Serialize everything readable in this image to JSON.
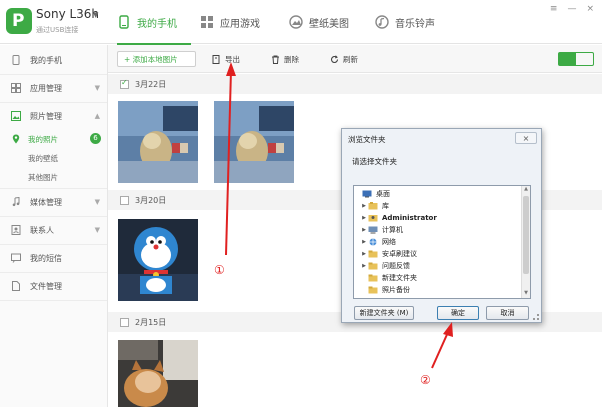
{
  "device": {
    "name": "Sony L36h",
    "subtitle": "通过USB连接",
    "logo_letter": "P"
  },
  "tabs": [
    {
      "label": "我的手机"
    },
    {
      "label": "应用游戏"
    },
    {
      "label": "壁纸美图"
    },
    {
      "label": "音乐铃声"
    }
  ],
  "window_controls": {
    "menu": "≡",
    "minimize": "—",
    "close": "×"
  },
  "sidebar": {
    "my_phone": "我的手机",
    "app_mgmt": "应用管理",
    "photo_mgmt": "照片管理",
    "my_photos": "我的照片",
    "my_photos_count": "6",
    "my_wallpapers": "我的壁纸",
    "other_pictures": "其他图片",
    "media_mgmt": "媒体管理",
    "contacts": "联系人",
    "sms": "我的短信",
    "file_mgmt": "文件管理"
  },
  "toolbar": {
    "add_local": "+ 添加本地图片",
    "export": "导出",
    "delete": "删除",
    "refresh": "刷新"
  },
  "groups": [
    {
      "date": "3月22日",
      "checked": true
    },
    {
      "date": "3月20日",
      "checked": false
    },
    {
      "date": "2月15日",
      "checked": false
    }
  ],
  "dialog": {
    "title": "浏览文件夹",
    "close": "×",
    "prompt": "请选择文件夹",
    "tree": [
      {
        "label": "桌面",
        "bold": false
      },
      {
        "label": "库",
        "bold": false
      },
      {
        "label": "Administrator",
        "bold": true
      },
      {
        "label": "计算机",
        "bold": false
      },
      {
        "label": "网络",
        "bold": false
      },
      {
        "label": "安卓刷建议",
        "bold": false
      },
      {
        "label": "问题反馈",
        "bold": false
      },
      {
        "label": "新建文件夹",
        "bold": false
      },
      {
        "label": "照片备份",
        "bold": false
      }
    ],
    "new_folder": "新建文件夹 (M)",
    "ok": "确定",
    "cancel": "取消"
  },
  "annotations": {
    "one": "①",
    "two": "②"
  },
  "colors": {
    "accent": "#3daa45",
    "arrow": "#e02020"
  }
}
